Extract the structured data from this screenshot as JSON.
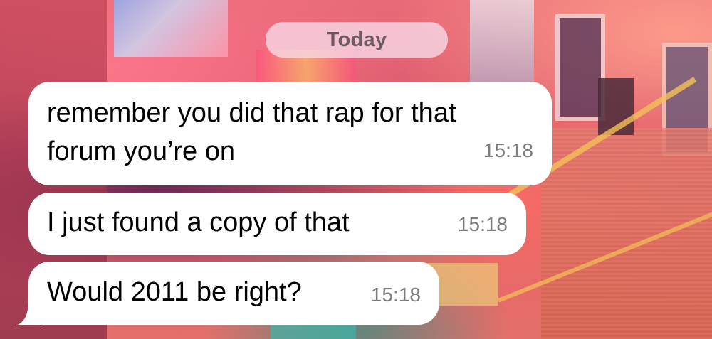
{
  "chat": {
    "date_separator": "Today",
    "messages": [
      {
        "lines": [
          "remember you did that rap for that",
          "forum you’re on"
        ],
        "time": "15:18"
      },
      {
        "lines": [
          "I just found a copy of that"
        ],
        "time": "15:18"
      },
      {
        "lines": [
          "Would 2011 be right?"
        ],
        "time": "15:18"
      }
    ]
  },
  "colors": {
    "bubble": "#ffffff",
    "text": "#000000",
    "timestamp": "#7d7d7d",
    "date_chip": "#f8d6e4"
  }
}
